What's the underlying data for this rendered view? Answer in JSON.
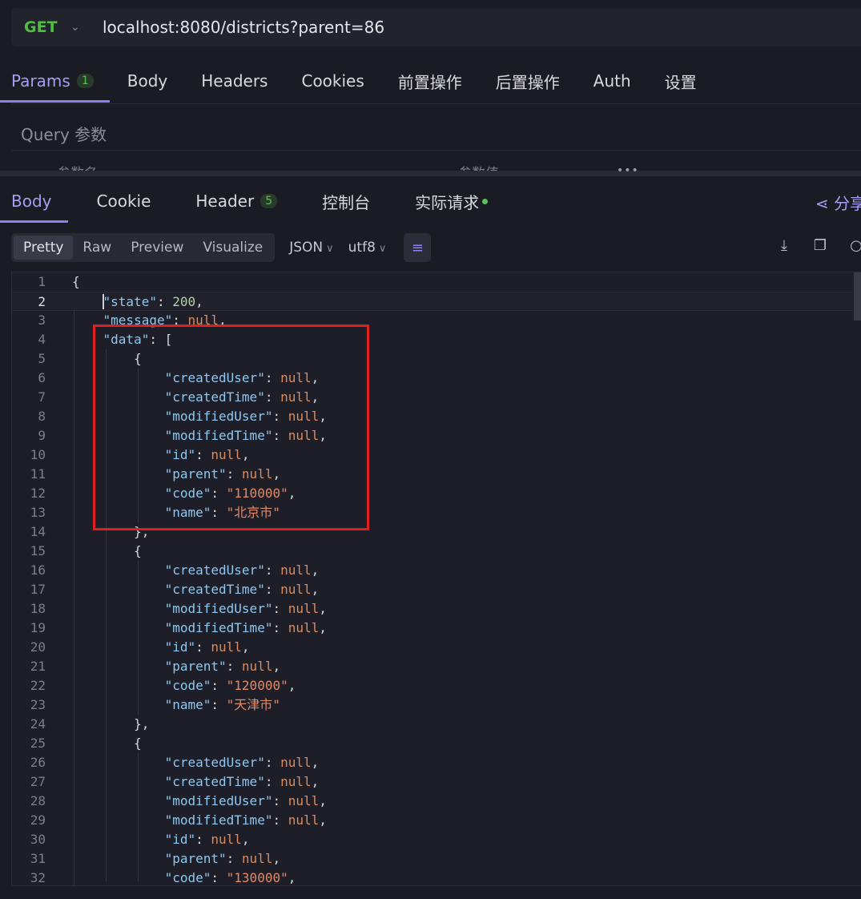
{
  "request": {
    "method": "GET",
    "url": "localhost:8080/districts?parent=86"
  },
  "request_tabs": [
    {
      "label": "Params",
      "badge": "1",
      "active": true
    },
    {
      "label": "Body"
    },
    {
      "label": "Headers"
    },
    {
      "label": "Cookies"
    },
    {
      "label": "前置操作"
    },
    {
      "label": "后置操作"
    },
    {
      "label": "Auth"
    },
    {
      "label": "设置"
    }
  ],
  "query": {
    "label": "Query 参数",
    "col_name": "参数名",
    "col_value": "参数值"
  },
  "response_tabs": [
    {
      "label": "Body",
      "active": true
    },
    {
      "label": "Cookie"
    },
    {
      "label": "Header",
      "badge": "5"
    },
    {
      "label": "控制台"
    },
    {
      "label": "实际请求",
      "dot": true
    }
  ],
  "share_label": "分享",
  "view_modes": [
    "Pretty",
    "Raw",
    "Preview",
    "Visualize"
  ],
  "format": "JSON",
  "encoding": "utf8",
  "colors": {
    "accent": "#8f80f0",
    "method": "#4fbf3f",
    "highlight": "#e02020"
  },
  "current_line": 2,
  "code_lines": [
    [
      {
        "t": "p",
        "v": "{"
      }
    ],
    [
      {
        "t": "p",
        "v": "    "
      },
      {
        "t": "k",
        "v": "\"state\""
      },
      {
        "t": "p",
        "v": ": "
      },
      {
        "t": "n",
        "v": "200"
      },
      {
        "t": "p",
        "v": ","
      }
    ],
    [
      {
        "t": "p",
        "v": "    "
      },
      {
        "t": "k",
        "v": "\"message\""
      },
      {
        "t": "p",
        "v": ": "
      },
      {
        "t": "nul",
        "v": "null"
      },
      {
        "t": "p",
        "v": ","
      }
    ],
    [
      {
        "t": "p",
        "v": "    "
      },
      {
        "t": "k",
        "v": "\"data\""
      },
      {
        "t": "p",
        "v": ": ["
      }
    ],
    [
      {
        "t": "p",
        "v": "        {"
      }
    ],
    [
      {
        "t": "p",
        "v": "            "
      },
      {
        "t": "k",
        "v": "\"createdUser\""
      },
      {
        "t": "p",
        "v": ": "
      },
      {
        "t": "nul",
        "v": "null"
      },
      {
        "t": "p",
        "v": ","
      }
    ],
    [
      {
        "t": "p",
        "v": "            "
      },
      {
        "t": "k",
        "v": "\"createdTime\""
      },
      {
        "t": "p",
        "v": ": "
      },
      {
        "t": "nul",
        "v": "null"
      },
      {
        "t": "p",
        "v": ","
      }
    ],
    [
      {
        "t": "p",
        "v": "            "
      },
      {
        "t": "k",
        "v": "\"modifiedUser\""
      },
      {
        "t": "p",
        "v": ": "
      },
      {
        "t": "nul",
        "v": "null"
      },
      {
        "t": "p",
        "v": ","
      }
    ],
    [
      {
        "t": "p",
        "v": "            "
      },
      {
        "t": "k",
        "v": "\"modifiedTime\""
      },
      {
        "t": "p",
        "v": ": "
      },
      {
        "t": "nul",
        "v": "null"
      },
      {
        "t": "p",
        "v": ","
      }
    ],
    [
      {
        "t": "p",
        "v": "            "
      },
      {
        "t": "k",
        "v": "\"id\""
      },
      {
        "t": "p",
        "v": ": "
      },
      {
        "t": "nul",
        "v": "null"
      },
      {
        "t": "p",
        "v": ","
      }
    ],
    [
      {
        "t": "p",
        "v": "            "
      },
      {
        "t": "k",
        "v": "\"parent\""
      },
      {
        "t": "p",
        "v": ": "
      },
      {
        "t": "nul",
        "v": "null"
      },
      {
        "t": "p",
        "v": ","
      }
    ],
    [
      {
        "t": "p",
        "v": "            "
      },
      {
        "t": "k",
        "v": "\"code\""
      },
      {
        "t": "p",
        "v": ": "
      },
      {
        "t": "s",
        "v": "\"110000\""
      },
      {
        "t": "p",
        "v": ","
      }
    ],
    [
      {
        "t": "p",
        "v": "            "
      },
      {
        "t": "k",
        "v": "\"name\""
      },
      {
        "t": "p",
        "v": ": "
      },
      {
        "t": "s",
        "v": "\"北京市\""
      }
    ],
    [
      {
        "t": "p",
        "v": "        },"
      }
    ],
    [
      {
        "t": "p",
        "v": "        {"
      }
    ],
    [
      {
        "t": "p",
        "v": "            "
      },
      {
        "t": "k",
        "v": "\"createdUser\""
      },
      {
        "t": "p",
        "v": ": "
      },
      {
        "t": "nul",
        "v": "null"
      },
      {
        "t": "p",
        "v": ","
      }
    ],
    [
      {
        "t": "p",
        "v": "            "
      },
      {
        "t": "k",
        "v": "\"createdTime\""
      },
      {
        "t": "p",
        "v": ": "
      },
      {
        "t": "nul",
        "v": "null"
      },
      {
        "t": "p",
        "v": ","
      }
    ],
    [
      {
        "t": "p",
        "v": "            "
      },
      {
        "t": "k",
        "v": "\"modifiedUser\""
      },
      {
        "t": "p",
        "v": ": "
      },
      {
        "t": "nul",
        "v": "null"
      },
      {
        "t": "p",
        "v": ","
      }
    ],
    [
      {
        "t": "p",
        "v": "            "
      },
      {
        "t": "k",
        "v": "\"modifiedTime\""
      },
      {
        "t": "p",
        "v": ": "
      },
      {
        "t": "nul",
        "v": "null"
      },
      {
        "t": "p",
        "v": ","
      }
    ],
    [
      {
        "t": "p",
        "v": "            "
      },
      {
        "t": "k",
        "v": "\"id\""
      },
      {
        "t": "p",
        "v": ": "
      },
      {
        "t": "nul",
        "v": "null"
      },
      {
        "t": "p",
        "v": ","
      }
    ],
    [
      {
        "t": "p",
        "v": "            "
      },
      {
        "t": "k",
        "v": "\"parent\""
      },
      {
        "t": "p",
        "v": ": "
      },
      {
        "t": "nul",
        "v": "null"
      },
      {
        "t": "p",
        "v": ","
      }
    ],
    [
      {
        "t": "p",
        "v": "            "
      },
      {
        "t": "k",
        "v": "\"code\""
      },
      {
        "t": "p",
        "v": ": "
      },
      {
        "t": "s",
        "v": "\"120000\""
      },
      {
        "t": "p",
        "v": ","
      }
    ],
    [
      {
        "t": "p",
        "v": "            "
      },
      {
        "t": "k",
        "v": "\"name\""
      },
      {
        "t": "p",
        "v": ": "
      },
      {
        "t": "s",
        "v": "\"天津市\""
      }
    ],
    [
      {
        "t": "p",
        "v": "        },"
      }
    ],
    [
      {
        "t": "p",
        "v": "        {"
      }
    ],
    [
      {
        "t": "p",
        "v": "            "
      },
      {
        "t": "k",
        "v": "\"createdUser\""
      },
      {
        "t": "p",
        "v": ": "
      },
      {
        "t": "nul",
        "v": "null"
      },
      {
        "t": "p",
        "v": ","
      }
    ],
    [
      {
        "t": "p",
        "v": "            "
      },
      {
        "t": "k",
        "v": "\"createdTime\""
      },
      {
        "t": "p",
        "v": ": "
      },
      {
        "t": "nul",
        "v": "null"
      },
      {
        "t": "p",
        "v": ","
      }
    ],
    [
      {
        "t": "p",
        "v": "            "
      },
      {
        "t": "k",
        "v": "\"modifiedUser\""
      },
      {
        "t": "p",
        "v": ": "
      },
      {
        "t": "nul",
        "v": "null"
      },
      {
        "t": "p",
        "v": ","
      }
    ],
    [
      {
        "t": "p",
        "v": "            "
      },
      {
        "t": "k",
        "v": "\"modifiedTime\""
      },
      {
        "t": "p",
        "v": ": "
      },
      {
        "t": "nul",
        "v": "null"
      },
      {
        "t": "p",
        "v": ","
      }
    ],
    [
      {
        "t": "p",
        "v": "            "
      },
      {
        "t": "k",
        "v": "\"id\""
      },
      {
        "t": "p",
        "v": ": "
      },
      {
        "t": "nul",
        "v": "null"
      },
      {
        "t": "p",
        "v": ","
      }
    ],
    [
      {
        "t": "p",
        "v": "            "
      },
      {
        "t": "k",
        "v": "\"parent\""
      },
      {
        "t": "p",
        "v": ": "
      },
      {
        "t": "nul",
        "v": "null"
      },
      {
        "t": "p",
        "v": ","
      }
    ],
    [
      {
        "t": "p",
        "v": "            "
      },
      {
        "t": "k",
        "v": "\"code\""
      },
      {
        "t": "p",
        "v": ": "
      },
      {
        "t": "s",
        "v": "\"130000\""
      },
      {
        "t": "p",
        "v": ","
      }
    ]
  ]
}
